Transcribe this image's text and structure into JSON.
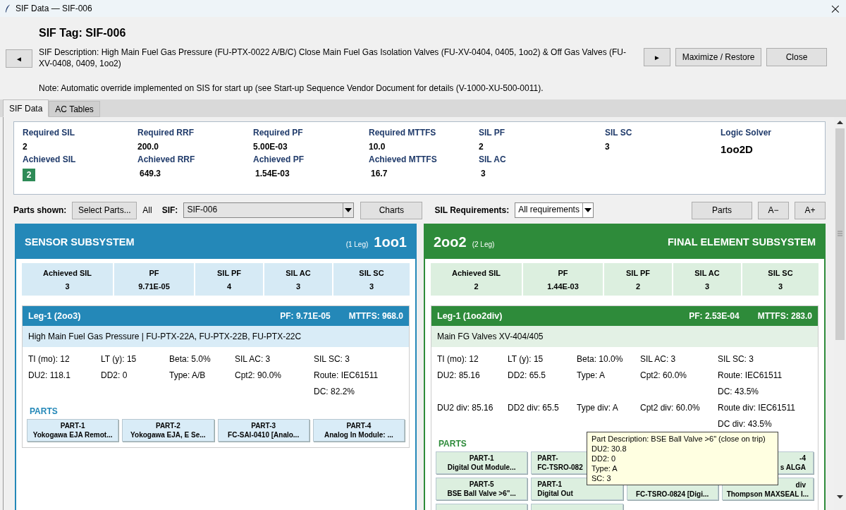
{
  "window": {
    "title": "SIF Data — SIF-006",
    "close": "×"
  },
  "header": {
    "title": "SIF Tag: SIF-006",
    "prev": "◄",
    "next": "►",
    "description": "SIF Description: High Main Fuel Gas Pressure (FU-PTX-0022 A/B/C) Close Main Fuel Gas Isolation Valves (FU-XV-0404, 0405, 1oo2) & Off Gas Valves (FU-XV-0408, 0409, 1oo2)",
    "note": "Note: Automatic override implemented on SIS for start up (see Start-up Sequence Vendor Document for details (V-1000-XU-500-0011).",
    "buttons": [
      "Maximize / Restore",
      "Close"
    ]
  },
  "tabs": [
    {
      "label": "SIF Data",
      "selected": true
    },
    {
      "label": "AC Tables",
      "selected": false
    }
  ],
  "summary": [
    {
      "top": {
        "label": "Required SIL",
        "value": "2"
      },
      "bottom": {
        "label": "Achieved SIL",
        "value": "2",
        "kind": "badge",
        "color": "#2e8b57"
      }
    },
    {
      "top": {
        "label": "Required RRF",
        "value": "200.0"
      },
      "bottom": {
        "label": "Achieved RRF",
        "value": "649.3",
        "kind": "plain"
      }
    },
    {
      "top": {
        "label": "Required PF",
        "value": "5.00E-03"
      },
      "bottom": {
        "label": "Achieved PF",
        "value": "1.54E-03",
        "kind": "plain"
      }
    },
    {
      "top": {
        "label": "Required MTTFS",
        "value": "10.0"
      },
      "bottom": {
        "label": "Achieved MTTFS",
        "value": "16.7",
        "kind": "plain"
      }
    },
    {
      "top": {
        "label": "SIL PF",
        "value": "2"
      },
      "bottom": {
        "label": "SIL AC",
        "value": "3",
        "kind": "plain"
      }
    },
    {
      "top": {
        "label": "SIL SC",
        "value": "3"
      }
    },
    {
      "top": {
        "label": "Logic Solver",
        "value": "1oo2D",
        "kind": "large"
      }
    }
  ],
  "toolbar": {
    "parts_label": "Parts shown:",
    "select_parts": "Select Parts...",
    "parts_value": "All",
    "sif_label": "SIF:",
    "sif_value": "SIF-006",
    "charts": "Charts",
    "req_label": "SIL Requirements:",
    "req_value": "All requirements",
    "buttons": [
      "Parts",
      "A−",
      "A+"
    ]
  },
  "subsystems": [
    {
      "kind": "sensor",
      "title": "SENSOR SUBSYSTEM",
      "legs": "(1 Leg)",
      "voting": "1oo1",
      "metrics": [
        {
          "label": "Achieved SIL",
          "value": "3"
        },
        {
          "label": "PF",
          "value": "9.71E-05"
        },
        {
          "label": "SIL PF",
          "value": "4"
        },
        {
          "label": "SIL AC",
          "value": "3"
        },
        {
          "label": "SIL SC",
          "value": "3"
        }
      ],
      "leg": {
        "name": "Leg-1 (2oo3)",
        "pf": "PF: 9.71E-05",
        "mttfs": "MTTFS: 968.0",
        "description": "High Main Fuel Gas Pressure | FU-PTX-22A, FU-PTX-22B, FU-PTX-22C",
        "params": [
          [
            "TI (mo): 12",
            "LT (y): 15",
            "Beta: 5.0%",
            "SIL AC: 3",
            "SIL SC: 3"
          ],
          [
            "DU2: 118.1",
            "DD2: 0",
            "Type: A/B",
            "Cpt2: 90.0%",
            "Route: IEC61511"
          ],
          [
            "DC: 82.2%"
          ]
        ],
        "parts_heading": "PARTS",
        "parts": [
          {
            "id": "PART-1",
            "name": "Yokogawa EJA Remot..."
          },
          {
            "id": "PART-2",
            "name": "Yokogawa EJA, E Se..."
          },
          {
            "id": "PART-3",
            "name": "FC-SAI-0410 [Analo..."
          },
          {
            "id": "PART-4",
            "name": "Analog In Module: ..."
          }
        ]
      }
    },
    {
      "kind": "final",
      "title": "FINAL ELEMENT SUBSYSTEM",
      "legs": "(2 Leg)",
      "voting": "2oo2",
      "metrics": [
        {
          "label": "Achieved SIL",
          "value": "2"
        },
        {
          "label": "PF",
          "value": "1.44E-03"
        },
        {
          "label": "SIL PF",
          "value": "2"
        },
        {
          "label": "SIL AC",
          "value": "3"
        },
        {
          "label": "SIL SC",
          "value": "3"
        }
      ],
      "leg": {
        "name": "Leg-1 (1oo2div)",
        "pf": "PF: 2.53E-04",
        "mttfs": "MTTFS: 283.0",
        "description": "Main FG Valves XV-404/405",
        "params": [
          [
            "TI (mo): 12",
            "LT (y): 15",
            "Beta: 10.0%",
            "SIL AC: 3",
            "SIL SC: 3"
          ],
          [
            "DU2: 85.16",
            "DD2: 65.5",
            "Type: A",
            "Cpt2: 60.0%",
            "Route: IEC61511"
          ],
          [
            "DC: 43.5%"
          ],
          [
            "DU2 div: 85.16",
            "DD2 div: 65.5",
            "Type div: A",
            "Cpt2 div: 60.0%",
            "Route div: IEC61511"
          ],
          [
            "DC div: 43.5%"
          ]
        ],
        "parts_heading": "PARTS",
        "parts": [
          {
            "id": "PART-1",
            "name": "Digital Out Module..."
          },
          {
            "id": "PART-",
            "name": "FC-TSRO-082",
            "kind": "left-part"
          },
          {
            "kind": "covered"
          },
          {
            "id": "-4",
            "name": "s ALGA",
            "kind": "right-part"
          },
          {
            "id": "PART-5",
            "name": "BSE Ball Valve >6\"..."
          },
          {
            "id": "PART-1",
            "name": "Digital Out",
            "kind": "left-part"
          },
          {
            "name": "FC-TSRO-0824 [Digi...",
            "kind": "lower-part"
          },
          {
            "id": "div",
            "name": "Thompson MAXSEAL I...",
            "kind": "lower-part"
          },
          {
            "kind": "cut"
          },
          {
            "kind": "cut"
          }
        ],
        "tooltip": [
          "Part Description: BSE Ball Valve >6\" (close on trip)",
          "DU2: 30.8",
          "DD2: 0",
          "Type: A",
          "SC: 3"
        ]
      }
    }
  ]
}
